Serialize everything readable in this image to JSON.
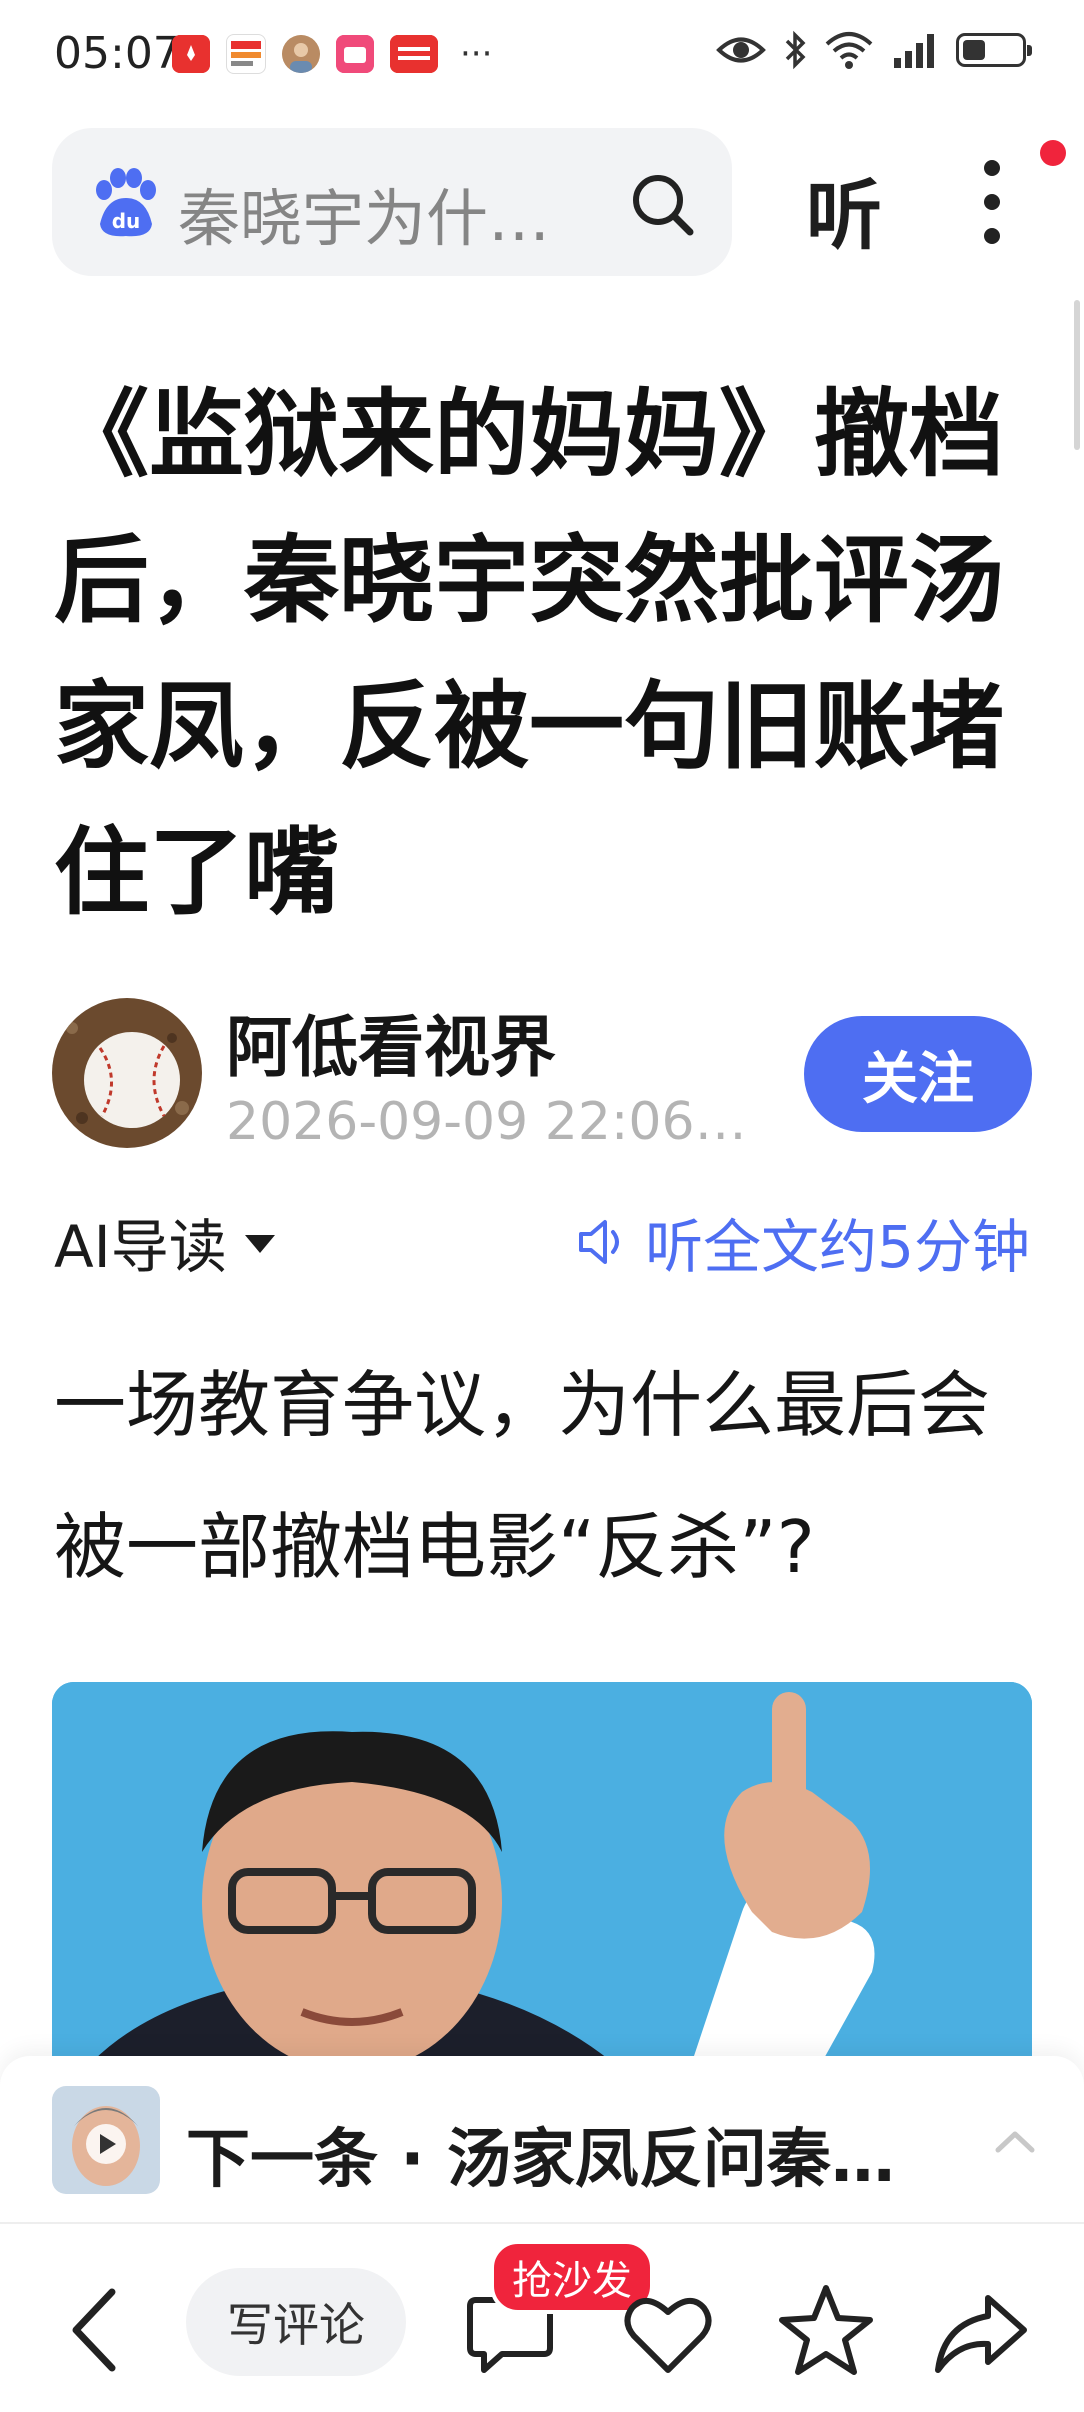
{
  "status_bar": {
    "time": "05:07",
    "apps": [
      {
        "name": "huawei-app",
        "label": "HUAWEI",
        "color": "#e8312f"
      },
      {
        "name": "news-app",
        "label": "视频",
        "color": "#ffffff"
      },
      {
        "name": "avatar-app",
        "label": "",
        "color": "#c8a27a"
      },
      {
        "name": "shop-app",
        "label": "Lala",
        "color": "#f04a7a"
      },
      {
        "name": "toutiao-app",
        "label": "头条",
        "color": "#e8312f"
      }
    ],
    "more": "···"
  },
  "header": {
    "search_text": "秦晓宇为什…",
    "listen_label": "听"
  },
  "article": {
    "title": "《监狱来的妈妈》撤档后，秦晓宇突然批评汤家凤，反被一句旧账堵住了嘴",
    "author": "阿低看视界",
    "publish_time": "2026-09-09 22:06…",
    "follow_label": "关注",
    "ai_guide_label": "AI导读",
    "listen_full_label": "听全文约5分钟",
    "lead": "一场教育争议，为什么最后会被一部撤档电影“反杀”?"
  },
  "next_item": {
    "text": "下一条 · 汤家凤反问秦…"
  },
  "toolbar": {
    "comment_placeholder": "写评论",
    "sofa_badge": "抢沙发"
  },
  "colors": {
    "accent": "#4e6ef2",
    "badge_red": "#f0243c"
  }
}
